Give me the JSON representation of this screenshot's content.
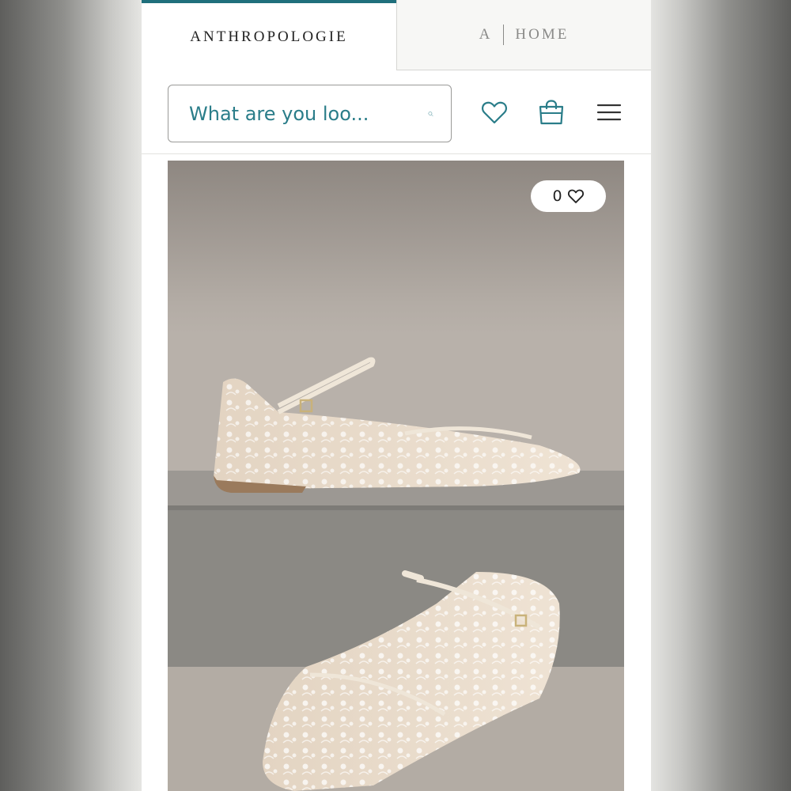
{
  "brand_tabs": {
    "active_label": "ANTHROPOLOGIE",
    "home_prefix": "A",
    "home_label": "HOME"
  },
  "header": {
    "search_placeholder": "What are you loo...",
    "icons": [
      "search-icon",
      "heart-icon",
      "shopping-bag-icon",
      "hamburger-menu-icon"
    ]
  },
  "product": {
    "like_count": "0",
    "colors": {
      "accent": "#1f6f7c",
      "icon": "#2a7d89"
    }
  }
}
